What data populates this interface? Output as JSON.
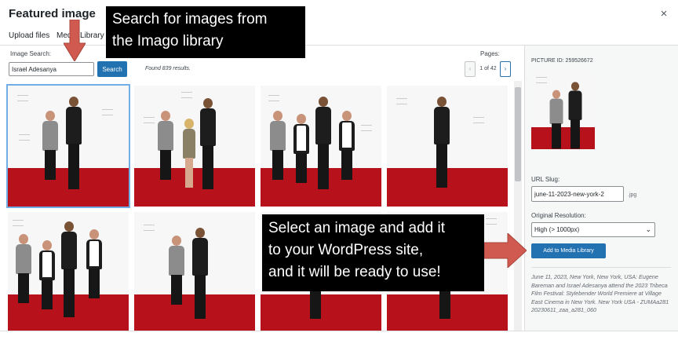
{
  "modal": {
    "title": "Featured image",
    "close_label": "×"
  },
  "tabs": {
    "upload": "Upload files",
    "media": "Media Library"
  },
  "search": {
    "label": "Image Search:",
    "value": "Israel Adesanya",
    "button": "Search",
    "results": "Found 839 results."
  },
  "pagination": {
    "label": "Pages:",
    "prev": "‹",
    "current": "1 of 42",
    "next": "›"
  },
  "thumbnails": [
    {
      "name": "thumb-1",
      "selected": true
    },
    {
      "name": "thumb-2",
      "selected": false
    },
    {
      "name": "thumb-3",
      "selected": false
    },
    {
      "name": "thumb-4",
      "selected": false
    },
    {
      "name": "thumb-5",
      "selected": false
    },
    {
      "name": "thumb-6",
      "selected": false
    },
    {
      "name": "thumb-7",
      "selected": false
    },
    {
      "name": "thumb-8",
      "selected": false
    }
  ],
  "details": {
    "picture_id": "PICTURE ID: 259526672",
    "slug_label": "URL Slug:",
    "slug_value": "june-11-2023-new-york-2",
    "slug_ext": ".jpg",
    "resolution_label": "Original Resolution:",
    "resolution_value": "High (> 1000px)",
    "add_button": "Add to Media Library",
    "caption": "June 11, 2023, New York, New York, USA: Eugene Bareman and Israel Adesanya attend the 2023 Tribeca Film Festival: Stylebender World Premiere at Village East Cinema in New York. New York USA - ZUMAa281 20230611_zaa_a281_060"
  },
  "callouts": {
    "top_line1": "Search for images from",
    "top_line2": "the Imago library",
    "mid_line1": "Select an image and add it",
    "mid_line2": "to your WordPress site,",
    "mid_line3": "and it will be ready to use!"
  },
  "colors": {
    "accent": "#2271b1",
    "arrow": "#d05a50",
    "carpet": "#b7121b",
    "callout_bg": "#000000"
  }
}
